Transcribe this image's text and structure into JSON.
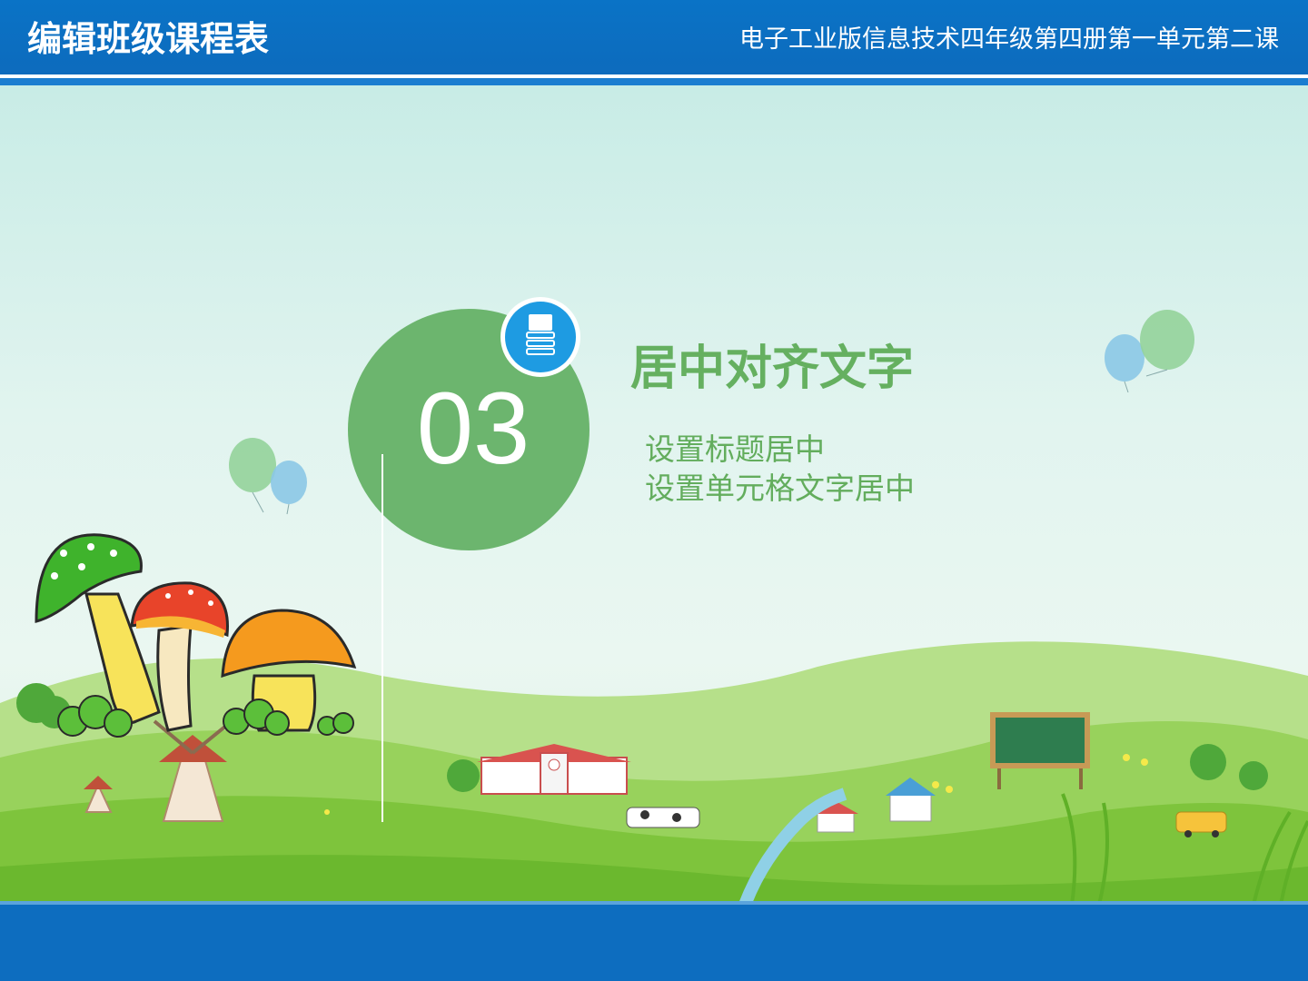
{
  "header": {
    "title": "编辑班级课程表",
    "subtitle": "电子工业版信息技术四年级第四册第一单元第二课"
  },
  "section": {
    "number": "03",
    "icon": "document-stack-icon",
    "title": "居中对齐文字",
    "items": [
      "设置标题居中",
      "设置单元格文字居中"
    ]
  },
  "colors": {
    "header_blue": "#0d6dbf",
    "accent_green": "#6cb56e",
    "icon_blue": "#1e9be2"
  }
}
